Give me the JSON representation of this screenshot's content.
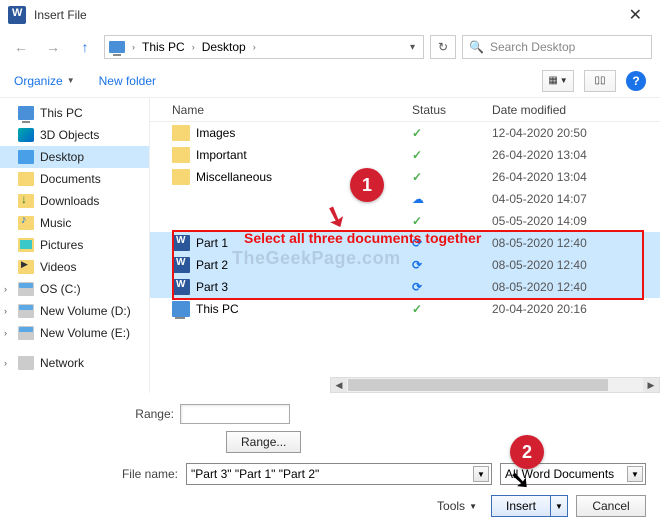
{
  "window": {
    "title": "Insert File"
  },
  "breadcrumb": {
    "loc1": "This PC",
    "loc2": "Desktop"
  },
  "search": {
    "placeholder": "Search Desktop"
  },
  "toolbar": {
    "organize": "Organize",
    "newfolder": "New folder"
  },
  "columns": {
    "name": "Name",
    "status": "Status",
    "date": "Date modified"
  },
  "sidebar": {
    "thispc": "This PC",
    "objects3d": "3D Objects",
    "desktop": "Desktop",
    "documents": "Documents",
    "downloads": "Downloads",
    "music": "Music",
    "pictures": "Pictures",
    "videos": "Videos",
    "osc": "OS (C:)",
    "voled": "New Volume (D:)",
    "volee": "New Volume (E:)",
    "network": "Network"
  },
  "files": {
    "images": {
      "name": "Images",
      "date": "12-04-2020 20:50"
    },
    "important": {
      "name": "Important",
      "date": "26-04-2020 13:04"
    },
    "miscellaneous": {
      "name": "Miscellaneous",
      "date": "26-04-2020 13:04"
    },
    "blankrow": {
      "name": "",
      "date": "04-05-2020 14:07"
    },
    "blankrow2": {
      "name": "",
      "date": "05-05-2020 14:09"
    },
    "part1": {
      "name": "Part 1",
      "date": "08-05-2020 12:40"
    },
    "part2": {
      "name": "Part 2",
      "date": "08-05-2020 12:40"
    },
    "part3": {
      "name": "Part 3",
      "date": "08-05-2020 12:40"
    },
    "thispc_short": {
      "name": "This PC",
      "date": "20-04-2020 20:16"
    }
  },
  "range": {
    "label": "Range:",
    "button": "Range..."
  },
  "filename": {
    "label": "File name:",
    "value": "\"Part 3\" \"Part 1\" \"Part 2\""
  },
  "filetype": {
    "value": "All Word Documents"
  },
  "actions": {
    "tools": "Tools",
    "insert": "Insert",
    "cancel": "Cancel"
  },
  "annotation": {
    "c1": "1",
    "c2": "2",
    "text": "Select all three documents together"
  },
  "watermark": "TheGeekPage.com"
}
